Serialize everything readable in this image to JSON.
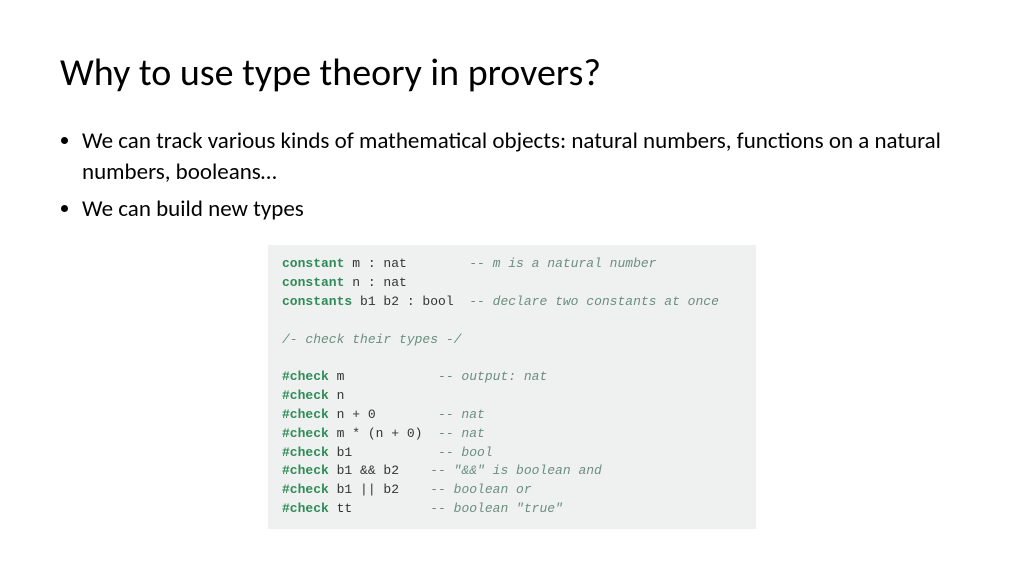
{
  "title": "Why to use type theory in provers?",
  "bullets": [
    "We can track various kinds of mathematical objects: natural numbers, functions on a natural numbers, booleans…",
    "We can build new types"
  ],
  "code": {
    "l1_kw": "constant",
    "l1_rest": " m : nat        ",
    "l1_cmt": "-- m is a natural number",
    "l2_kw": "constant",
    "l2_rest": " n : nat",
    "l3_kw": "constants",
    "l3_rest": " b1 b2 : bool  ",
    "l3_cmt": "-- declare two constants at once",
    "l4_cmt": "/- check their types -/",
    "l5_kw": "#check",
    "l5_rest": " m            ",
    "l5_cmt": "-- output: nat",
    "l6_kw": "#check",
    "l6_rest": " n",
    "l7_kw": "#check",
    "l7_rest": " n + 0        ",
    "l7_cmt": "-- nat",
    "l8_kw": "#check",
    "l8_rest": " m * (n + 0)  ",
    "l8_cmt": "-- nat",
    "l9_kw": "#check",
    "l9_rest": " b1           ",
    "l9_cmt": "-- bool",
    "l10_kw": "#check",
    "l10_rest": " b1 && b2    ",
    "l10_cmt": "-- \"&&\" is boolean and",
    "l11_kw": "#check",
    "l11_rest": " b1 || b2    ",
    "l11_cmt": "-- boolean or",
    "l12_kw": "#check",
    "l12_rest": " tt          ",
    "l12_cmt": "-- boolean \"true\""
  }
}
